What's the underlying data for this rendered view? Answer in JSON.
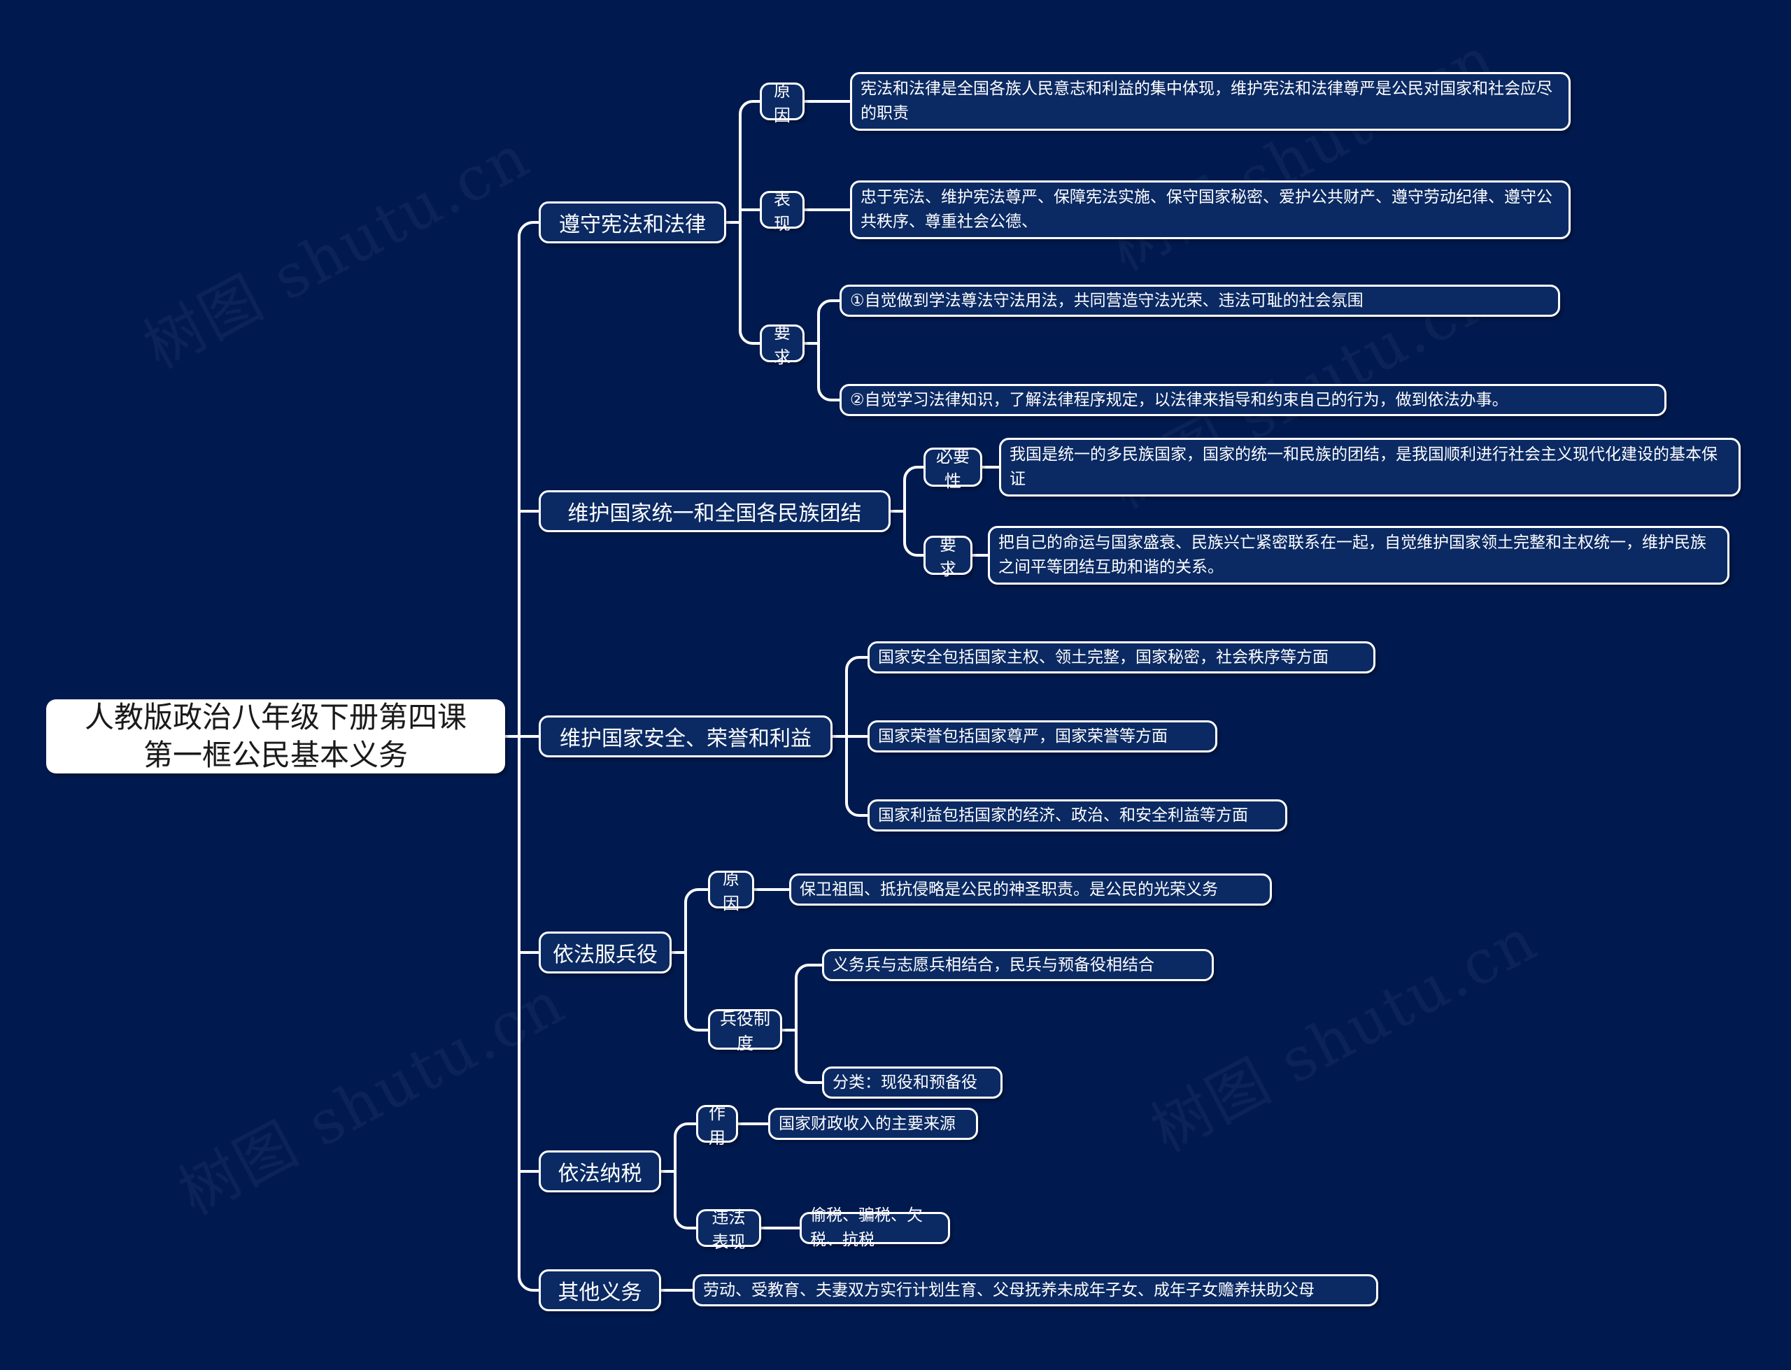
{
  "theme": {
    "background": "#001a50",
    "node_fill": "#0b2a63",
    "node_border": "#ffffff",
    "root_fill": "#ffffff",
    "root_text": "#1a1a1a",
    "text": "#ffffff",
    "link": "#ffffff"
  },
  "watermark": {
    "text": "树图 shutu.cn"
  },
  "root": {
    "label": "人教版政治八年级下册第四课\n第一框公民基本义务"
  },
  "branches": [
    {
      "label": "遵守宪法和法律",
      "children": [
        {
          "label": "原因",
          "leaves": [
            "宪法和法律是全国各族人民意志和利益的集中体现，维护宪法和法律尊严是公民对国家和社会应尽的职责"
          ]
        },
        {
          "label": "表现",
          "leaves": [
            "忠于宪法、维护宪法尊严、保障宪法实施、保守国家秘密、爱护公共财产、遵守劳动纪律、遵守公共秩序、尊重社会公德、"
          ]
        },
        {
          "label": "要求",
          "leaves": [
            "①自觉做到学法尊法守法用法，共同营造守法光荣、违法可耻的社会氛围",
            "②自觉学习法律知识，了解法律程序规定，以法律来指导和约束自己的行为，做到依法办事。"
          ]
        }
      ]
    },
    {
      "label": "维护国家统一和全国各民族团结",
      "children": [
        {
          "label": "必要性",
          "leaves": [
            "我国是统一的多民族国家，国家的统一和民族的团结，是我国顺利进行社会主义现代化建设的基本保证"
          ]
        },
        {
          "label": "要求",
          "leaves": [
            "把自己的命运与国家盛衰、民族兴亡紧密联系在一起，自觉维护国家领土完整和主权统一，维护民族之间平等团结互助和谐的关系。"
          ]
        }
      ]
    },
    {
      "label": "维护国家安全、荣誉和利益",
      "direct_leaves": [
        "国家安全包括国家主权、领土完整，国家秘密，社会秩序等方面",
        "国家荣誉包括国家尊严，国家荣誉等方面",
        "国家利益包括国家的经济、政治、和安全利益等方面"
      ]
    },
    {
      "label": "依法服兵役",
      "children": [
        {
          "label": "原因",
          "leaves": [
            "保卫祖国、抵抗侵略是公民的神圣职责。是公民的光荣义务"
          ]
        },
        {
          "label": "兵役制度",
          "leaves": [
            "义务兵与志愿兵相结合，民兵与预备役相结合",
            "分类：现役和预备役"
          ]
        }
      ]
    },
    {
      "label": "依法纳税",
      "children": [
        {
          "label": "作用",
          "leaves": [
            "国家财政收入的主要来源"
          ]
        },
        {
          "label": "违法表现",
          "leaves": [
            "偷税、骗税、欠税、抗税"
          ]
        }
      ]
    },
    {
      "label": "其他义务",
      "direct_leaves": [
        "劳动、受教育、夫妻双方实行计划生育、父母抚养未成年子女、成年子女赡养扶助父母"
      ]
    }
  ]
}
